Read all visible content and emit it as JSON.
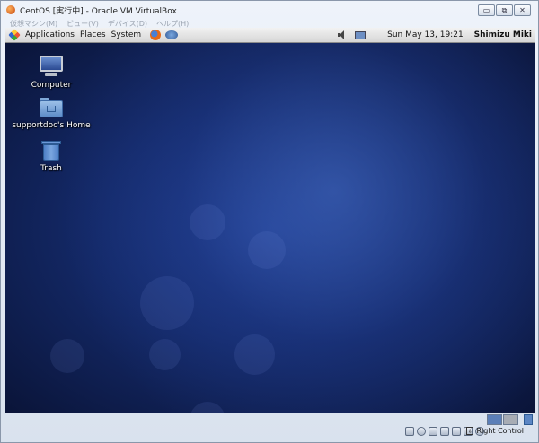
{
  "window": {
    "title": "CentOS [実行中] - Oracle VM VirtualBox",
    "controls": [
      "minimize",
      "restore",
      "close"
    ]
  },
  "vbox_menu": [
    "仮想マシン(M)",
    "ビュー(V)",
    "デバイス(D)",
    "ヘルプ(H)"
  ],
  "gnome_panel": {
    "applications": "Applications",
    "places": "Places",
    "system": "System",
    "clock": "Sun May 13, 19:21",
    "user": "Shimizu Miki"
  },
  "desktop_icons": [
    {
      "label": "Computer",
      "icon": "computer-icon"
    },
    {
      "label": "supportdoc's Home",
      "icon": "home-folder-icon"
    },
    {
      "label": "Trash",
      "icon": "trash-icon"
    }
  ],
  "statusbar": {
    "host_key": "Right Control",
    "icons": [
      "hard-disk-icon",
      "optical-drive-icon",
      "usb-icon",
      "network-icon",
      "shared-folder-icon",
      "display-icon",
      "mouse-integration-icon"
    ]
  },
  "colors": {
    "desktop": "#142a6a",
    "panel": "#e4e4e4",
    "window_chrome": "#dde5f0"
  }
}
